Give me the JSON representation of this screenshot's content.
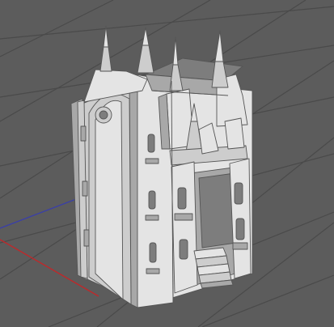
{
  "viewport": {
    "background": "#5c5c5c",
    "grid_color": "#4a4a4a"
  },
  "axes": {
    "x_color": "#c0282a",
    "z_color": "#3a3fa8"
  },
  "model": {
    "light": "#e4e4e4",
    "mid": "#cdcdcd",
    "shade": "#a8a8a8",
    "dark": "#7d7d7d",
    "outline": "#555555"
  }
}
